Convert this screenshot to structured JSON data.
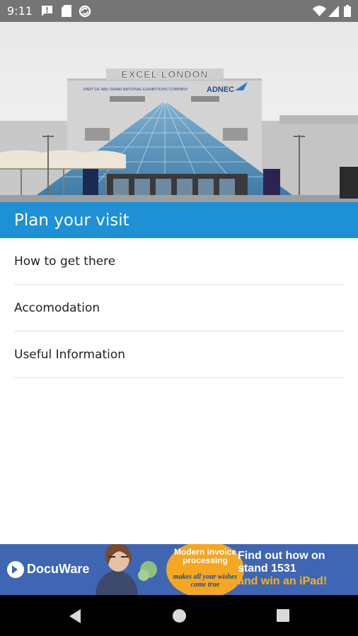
{
  "status_bar": {
    "time": "9:11",
    "left_icons": [
      "message-icon",
      "sim-card-icon",
      "sync-icon"
    ],
    "right_icons": [
      "wifi-icon",
      "signal-icon",
      "battery-icon"
    ]
  },
  "hero": {
    "sign_text": "EXCEL LONDON",
    "sub_text": "PART OF ABU DHABI NATIONAL EXHIBITIONS COMPANY",
    "brand_text": "ADNEC"
  },
  "banner": {
    "title": "Plan your visit",
    "color": "#1e90d6"
  },
  "menu": {
    "items": [
      {
        "label": "How to get there"
      },
      {
        "label": "Accomodation"
      },
      {
        "label": "Useful Information"
      }
    ]
  },
  "ad": {
    "logo_text": "DocuWare",
    "bubble_text": "Modern invoice processing",
    "bubble_sub": "makes all your wishes come true",
    "cta_line1": "Find out how on stand 1531",
    "cta_line2": "and win an iPad!"
  },
  "nav": {
    "icons": [
      "back-icon",
      "home-icon",
      "recents-icon"
    ]
  }
}
